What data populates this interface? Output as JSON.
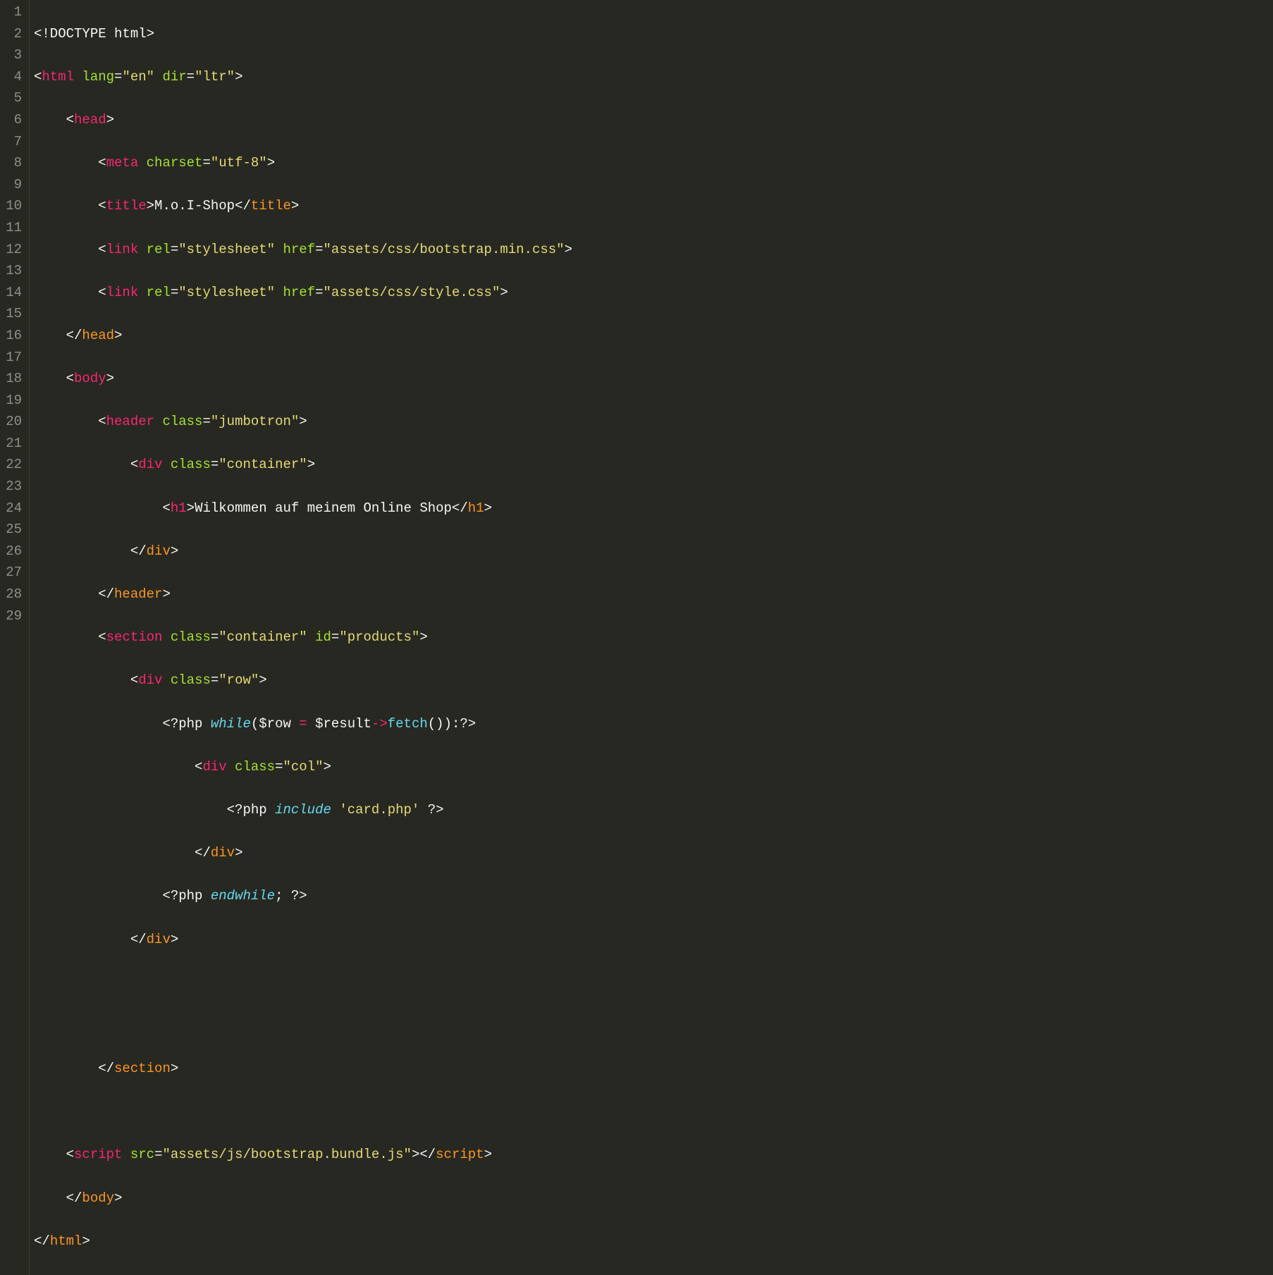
{
  "lines": {
    "1": "1",
    "2": "2",
    "3": "3",
    "4": "4",
    "5": "5",
    "6": "6",
    "7": "7",
    "8": "8",
    "9": "9",
    "10": "10",
    "11": "11",
    "12": "12",
    "13": "13",
    "14": "14",
    "15": "15",
    "16": "16",
    "17": "17",
    "18": "18",
    "19": "19",
    "20": "20",
    "21": "21",
    "22": "22",
    "23": "23",
    "24": "24",
    "25": "25",
    "26": "26",
    "27": "27",
    "28": "28",
    "29": "29"
  },
  "code": {
    "l1": {
      "doctype": "<!DOCTYPE html>"
    },
    "l2": {
      "open": "<",
      "tag": "html",
      "sp1": " ",
      "a1": "lang",
      "eq1": "=",
      "v1": "\"en\"",
      "sp2": " ",
      "a2": "dir",
      "eq2": "=",
      "v2": "\"ltr\"",
      "close": ">"
    },
    "l3": {
      "indent": "    ",
      "open": "<",
      "tag": "head",
      "close": ">"
    },
    "l4": {
      "indent": "        ",
      "open": "<",
      "tag": "meta",
      "sp1": " ",
      "a1": "charset",
      "eq1": "=",
      "v1": "\"utf-8\"",
      "close": ">"
    },
    "l5": {
      "indent": "        ",
      "open": "<",
      "tag": "title",
      "close1": ">",
      "text": "M.o.I-Shop",
      "open2": "</",
      "ctag": "title",
      "close2": ">"
    },
    "l6": {
      "indent": "        ",
      "open": "<",
      "tag": "link",
      "sp1": " ",
      "a1": "rel",
      "eq1": "=",
      "v1": "\"stylesheet\"",
      "sp2": " ",
      "a2": "href",
      "eq2": "=",
      "v2": "\"assets/css/bootstrap.min.css\"",
      "close": ">"
    },
    "l7": {
      "indent": "        ",
      "open": "<",
      "tag": "link",
      "sp1": " ",
      "a1": "rel",
      "eq1": "=",
      "v1": "\"stylesheet\"",
      "sp2": " ",
      "a2": "href",
      "eq2": "=",
      "v2": "\"assets/css/style.css\"",
      "close": ">"
    },
    "l8": {
      "indent": "    ",
      "open": "</",
      "ctag": "head",
      "close": ">"
    },
    "l9": {
      "indent": "    ",
      "open": "<",
      "tag": "body",
      "close": ">"
    },
    "l10": {
      "indent": "        ",
      "open": "<",
      "tag": "header",
      "sp1": " ",
      "a1": "class",
      "eq1": "=",
      "v1": "\"jumbotron\"",
      "close": ">"
    },
    "l11": {
      "indent": "            ",
      "open": "<",
      "tag": "div",
      "sp1": " ",
      "a1": "class",
      "eq1": "=",
      "v1": "\"container\"",
      "close": ">"
    },
    "l12": {
      "indent": "                ",
      "open": "<",
      "tag": "h1",
      "close1": ">",
      "text": "Wilkommen auf meinem Online Shop",
      "open2": "</",
      "ctag": "h1",
      "close2": ">"
    },
    "l13": {
      "indent": "            ",
      "open": "</",
      "ctag": "div",
      "close": ">"
    },
    "l14": {
      "indent": "        ",
      "open": "</",
      "ctag": "header",
      "close": ">"
    },
    "l15": {
      "indent": "        ",
      "open": "<",
      "tag": "section",
      "sp1": " ",
      "a1": "class",
      "eq1": "=",
      "v1": "\"container\"",
      "sp2": " ",
      "a2": "id",
      "eq2": "=",
      "v2": "\"products\"",
      "close": ">"
    },
    "l16": {
      "indent": "            ",
      "open": "<",
      "tag": "div",
      "sp1": " ",
      "a1": "class",
      "eq1": "=",
      "v1": "\"row\"",
      "close": ">"
    },
    "l17": {
      "indent": "                ",
      "phpo": "<?php ",
      "kw": "while",
      "p1": "(",
      "var1": "$row",
      "sp1": " ",
      "op1": "=",
      "sp2": " ",
      "var2": "$result",
      "op2": "->",
      "fn": "fetch",
      "p2": "()):",
      "phpc": "?>"
    },
    "l18": {
      "indent": "                    ",
      "open": "<",
      "tag": "div",
      "sp1": " ",
      "a1": "class",
      "eq1": "=",
      "v1": "\"col\"",
      "close": ">"
    },
    "l19": {
      "indent": "                        ",
      "phpo": "<?php ",
      "kw": "include",
      "sp1": " ",
      "str": "'card.php'",
      "sp2": " ",
      "phpc": "?>"
    },
    "l20": {
      "indent": "                    ",
      "open": "</",
      "ctag": "div",
      "close": ">"
    },
    "l21": {
      "indent": "                ",
      "phpo": "<?php ",
      "kw": "endwhile",
      "p1": ";",
      "sp1": " ",
      "phpc": "?>"
    },
    "l22": {
      "indent": "            ",
      "open": "</",
      "ctag": "div",
      "close": ">"
    },
    "l25": {
      "indent": "        ",
      "open": "</",
      "ctag": "section",
      "close": ">"
    },
    "l27": {
      "indent": "    ",
      "open": "<",
      "tag": "script",
      "sp1": " ",
      "a1": "src",
      "eq1": "=",
      "v1": "\"assets/js/bootstrap.bundle.js\"",
      "close1": ">",
      "open2": "</",
      "ctag": "script",
      "close2": ">"
    },
    "l28": {
      "indent": "    ",
      "open": "</",
      "ctag": "body",
      "close": ">"
    },
    "l29": {
      "open": "</",
      "ctag": "html",
      "close": ">"
    }
  }
}
